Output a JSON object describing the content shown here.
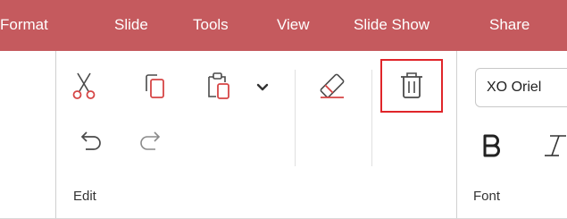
{
  "menu": {
    "items": [
      "Format",
      "Slide",
      "Tools",
      "View",
      "Slide Show",
      "Share"
    ]
  },
  "ribbon": {
    "edit_group": {
      "label": "Edit",
      "icons": [
        "cut-icon",
        "copy-icon",
        "paste-icon",
        "chevron-down-icon",
        "eraser-icon",
        "delete-icon",
        "undo-icon",
        "redo-icon"
      ]
    },
    "font_group": {
      "label": "Font",
      "font_name": "XO Oriel",
      "icons": [
        "bold-icon",
        "italic-icon"
      ]
    }
  },
  "colors": {
    "menubar_bg": "#c55a5e",
    "icon_stroke": "#4a4a4a",
    "accent_red": "#d64545",
    "highlight_border": "#e0252a"
  }
}
